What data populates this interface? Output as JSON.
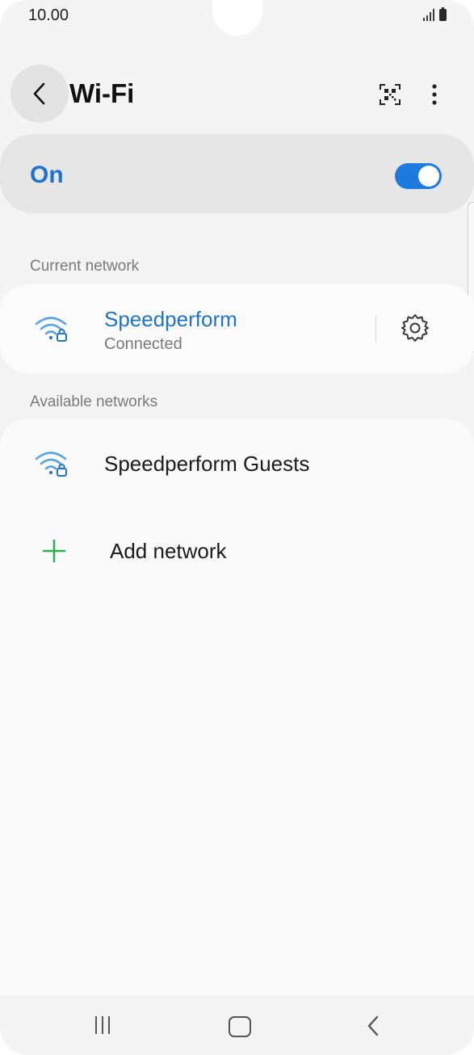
{
  "status_bar": {
    "time": "10.00"
  },
  "header": {
    "title": "Wi-Fi"
  },
  "wifi_toggle": {
    "label": "On",
    "state": true,
    "accent": "#1f74c9"
  },
  "current_network": {
    "section_label": "Current network",
    "name": "Speedperform",
    "status": "Connected"
  },
  "available_networks": {
    "section_label": "Available networks",
    "items": [
      {
        "name": "Speedperform Guests"
      }
    ],
    "add_label": "Add network"
  },
  "icons": {
    "back": "chevron-left-icon",
    "qr": "qr-code-icon",
    "more": "more-vertical-icon",
    "wifi": "wifi-lock-icon",
    "settings": "gear-icon",
    "add": "plus-icon"
  }
}
